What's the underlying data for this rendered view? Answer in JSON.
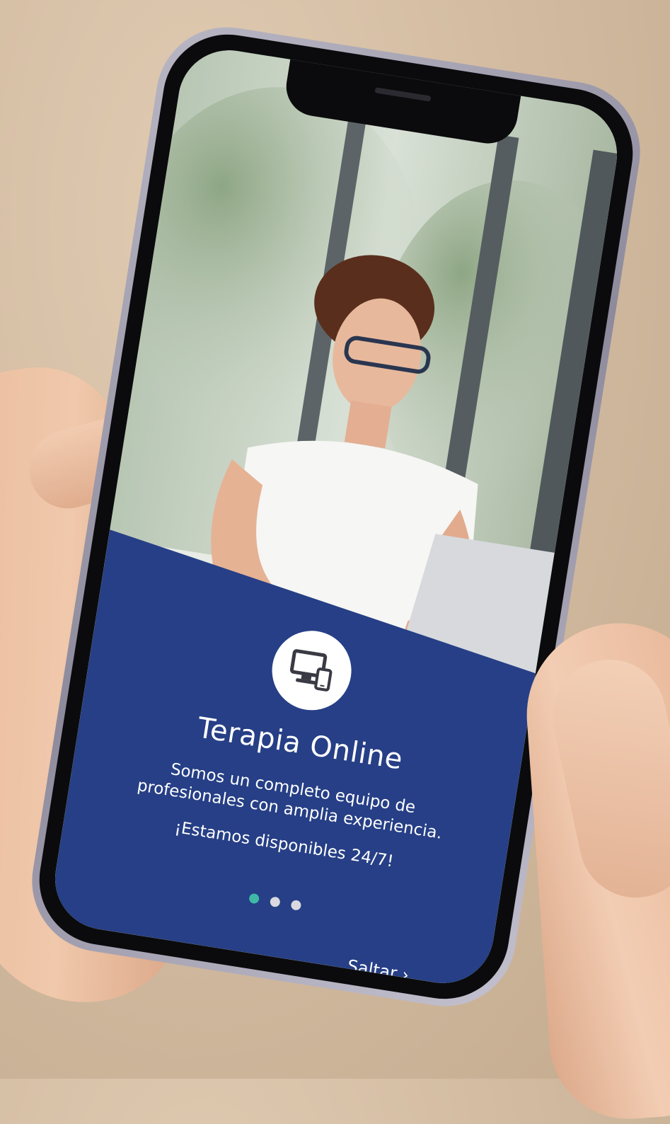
{
  "onboarding": {
    "title": "Terapia Online",
    "description": "Somos un completo equipo de profesionales con amplia experiencia.",
    "tagline": "¡Estamos disponibles 24/7!",
    "skip_label": "Saltar ›",
    "pagination": {
      "total": 3,
      "active_index": 0
    },
    "icon": "monitor-and-phone-icon"
  },
  "colors": {
    "card_background": "#263f86",
    "active_dot": "#3fb9a6",
    "inactive_dot": "#d9d9df",
    "text": "#ffffff"
  }
}
